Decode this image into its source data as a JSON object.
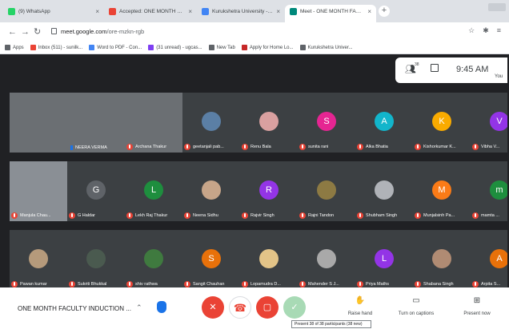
{
  "browser": {
    "tabs": [
      {
        "label": "(9) WhatsApp",
        "color": "#25d366",
        "active": false
      },
      {
        "label": "Accepted: ONE MONTH FACULT",
        "color": "#ea4335",
        "active": false
      },
      {
        "label": "Kurukshetra University - Calendar",
        "color": "#4285f4",
        "active": false
      },
      {
        "label": "Meet - ONE MONTH FACULT",
        "color": "#00897b",
        "active": true
      }
    ],
    "url_host": "meet.google.com",
    "url_path": "/ore-mzkn-rgb",
    "bookmarks": [
      {
        "label": "Apps",
        "color": "#5f6368"
      },
      {
        "label": "Inbox (511) - sunilk...",
        "color": "#ea4335"
      },
      {
        "label": "Word to PDF - Con...",
        "color": "#4285f4"
      },
      {
        "label": "(31 unread) - ugcas...",
        "color": "#7e3ff2"
      },
      {
        "label": "New Tab",
        "color": "#5f6368"
      },
      {
        "label": "Apply for Home Lo...",
        "color": "#c62828"
      },
      {
        "label": "Kurukshetra Univer...",
        "color": "#5f6368"
      }
    ]
  },
  "meet": {
    "people_count": "38",
    "time": "9:45 AM",
    "you_label": "You",
    "meeting_title": "ONE MONTH FACULTY INDUCTION ...",
    "tooltip": "Present 38 of 38 participants (38 new)",
    "raise_hand": "Raise hand",
    "captions": "Turn on captions",
    "present_now": "Present now",
    "participants": [
      {
        "name": "",
        "initial": "",
        "color": "#6b6f73",
        "video": true
      },
      {
        "name": "NEERA VERMA",
        "initial": "",
        "color": "#6b6f73",
        "video": true,
        "speaking": true
      },
      {
        "name": "Archana Thakur",
        "initial": "",
        "color": "#6b6f73",
        "video": true
      },
      {
        "name": "geetanjali pab...",
        "initial": "",
        "color": "#5b7fa5",
        "photo": true
      },
      {
        "name": "Renu Bala",
        "initial": "",
        "color": "#d9a0a0",
        "photo": true
      },
      {
        "name": "sunita rani",
        "initial": "S",
        "color": "#e52592"
      },
      {
        "name": "Alka Bhatia",
        "initial": "A",
        "color": "#12b5cb"
      },
      {
        "name": "Kishorkumar K...",
        "initial": "K",
        "color": "#f9ab00"
      },
      {
        "name": "Vibha V...",
        "initial": "V",
        "color": "#9334e6"
      },
      {
        "name": "Manjula Chau...",
        "initial": "",
        "color": "#8a8f95",
        "video": true
      },
      {
        "name": "G Haldar",
        "initial": "G",
        "color": "#5f6368"
      },
      {
        "name": "Lekh Raj Thakur",
        "initial": "L",
        "color": "#1e8e3e"
      },
      {
        "name": "Neena Sidhu",
        "initial": "",
        "color": "#c7a589",
        "photo": true
      },
      {
        "name": "Rajvir Singh",
        "initial": "R",
        "color": "#9334e6"
      },
      {
        "name": "Rajni Tandon",
        "initial": "",
        "color": "#8d7a43",
        "photo": true
      },
      {
        "name": "Shubham Singh",
        "initial": "",
        "color": "#b0b3b8",
        "photo": true
      },
      {
        "name": "Munjalsinh Pa...",
        "initial": "M",
        "color": "#fa7b17"
      },
      {
        "name": "mamta ...",
        "initial": "m",
        "color": "#1e8e3e"
      },
      {
        "name": "Pawan kumar",
        "initial": "",
        "color": "#b59a7b",
        "photo": true
      },
      {
        "name": "Sukriti Bhukkal",
        "initial": "",
        "color": "#4a5a4f",
        "photo": true
      },
      {
        "name": "shiv rathwa",
        "initial": "",
        "color": "#3f7a3f",
        "photo": true
      },
      {
        "name": "Sangit Chauhan",
        "initial": "S",
        "color": "#e8710a"
      },
      {
        "name": "Lopamudra D...",
        "initial": "",
        "color": "#e3c488",
        "photo": true
      },
      {
        "name": "Mahender S J...",
        "initial": "",
        "color": "#a9a9a9",
        "photo": true
      },
      {
        "name": "Priya Maths",
        "initial": "L",
        "color": "#9334e6"
      },
      {
        "name": "Shabana Singh",
        "initial": "",
        "color": "#b08b73",
        "photo": true
      },
      {
        "name": "Arpita S...",
        "initial": "A",
        "color": "#e8710a"
      }
    ]
  }
}
